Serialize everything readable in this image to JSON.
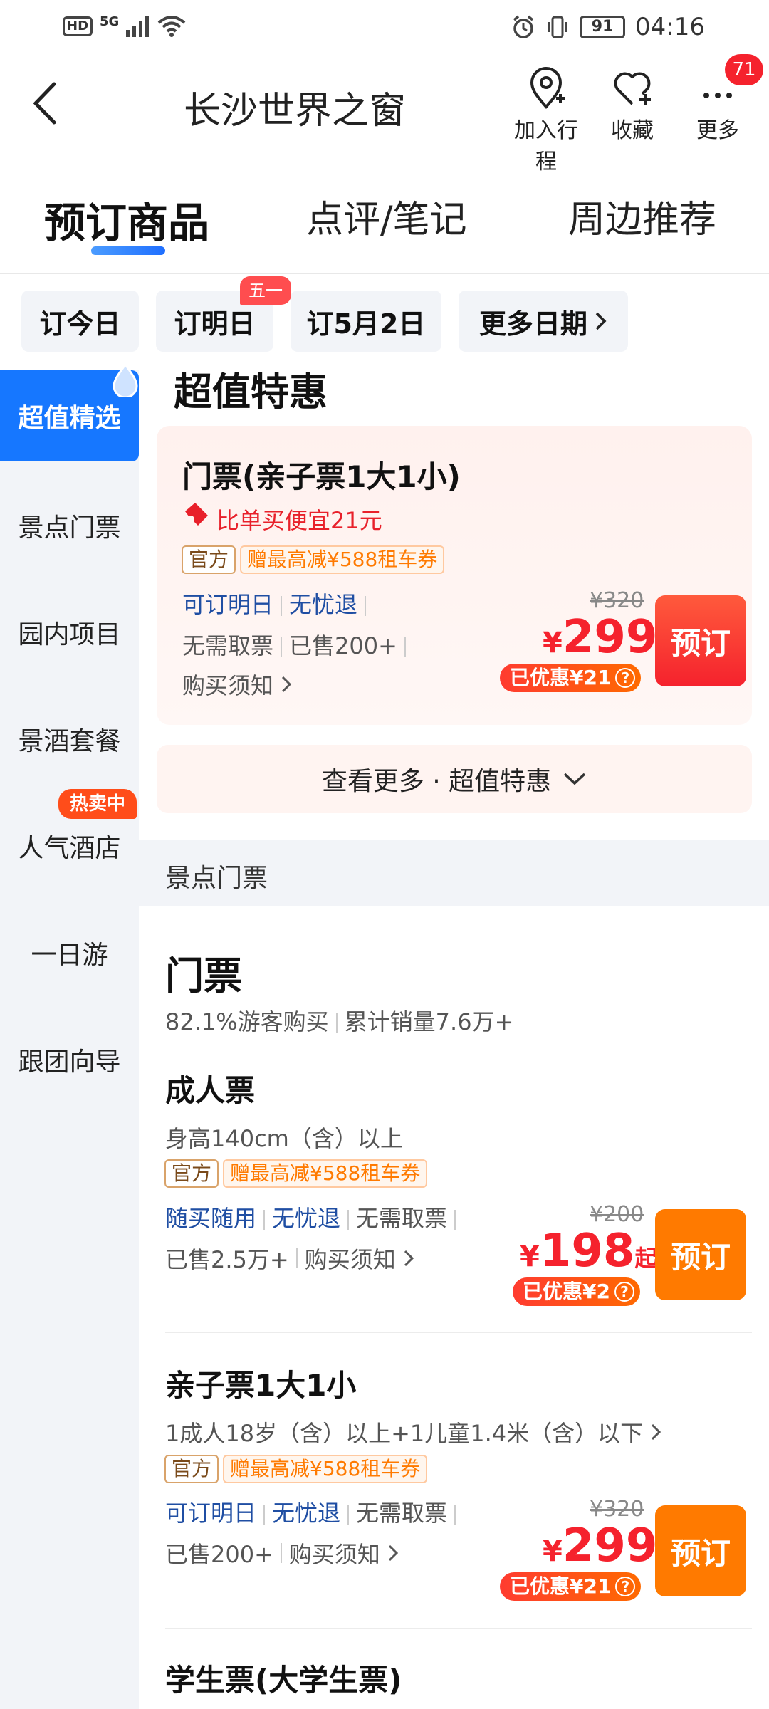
{
  "status_bar": {
    "hd": "HD",
    "network": "5G",
    "battery": "91",
    "time": "04:16"
  },
  "header": {
    "title": "长沙世界之窗",
    "actions": [
      {
        "label": "加入行程",
        "icon": "map-pin-plus-icon"
      },
      {
        "label": "收藏",
        "icon": "heart-plus-icon"
      },
      {
        "label": "更多",
        "icon": "more-dots-icon"
      }
    ],
    "notification_count": "71"
  },
  "tabs": [
    {
      "label": "预订商品",
      "active": true
    },
    {
      "label": "点评/笔记",
      "active": false
    },
    {
      "label": "周边推荐",
      "active": false
    }
  ],
  "date_chips": {
    "today": "订今日",
    "tomorrow": "订明日",
    "holiday_badge": "五一",
    "may2": "订5月2日",
    "more": "更多日期"
  },
  "sidebar": {
    "items": [
      "超值精选",
      "景点门票",
      "园内项目",
      "景酒套餐",
      "人气酒店",
      "一日游",
      "跟团向导"
    ],
    "active_index": 0,
    "hot_tag": "热卖中"
  },
  "deal_section": {
    "title": "超值特惠",
    "card": {
      "title": "门票(亲子票1大1小)",
      "savings": "比单买便宜21元",
      "tag_official": "官方",
      "tag_gift": "赠最高减¥588租车券",
      "feature1": "可订明日",
      "feature2": "无忧退",
      "feature3": "无需取票",
      "sold": "已售200+",
      "notice": "购买须知",
      "original_price": "¥320",
      "currency": "¥",
      "price": "299",
      "discount": "已优惠¥21",
      "book": "预订"
    },
    "more_label": "查看更多 · 超值特惠"
  },
  "ticket_section": {
    "band_label": "景点门票",
    "title": "门票",
    "buy_rate": "82.1%游客购买",
    "total_sales": "累计销量7.6万+",
    "products": [
      {
        "name": "成人票",
        "desc": "身高140cm（含）以上",
        "tag_official": "官方",
        "tag_gift": "赠最高减¥588租车券",
        "feature1": "随买随用",
        "feature2": "无忧退",
        "feature3": "无需取票",
        "sold": "已售2.5万+",
        "notice": "购买须知",
        "original_price": "¥200",
        "currency": "¥",
        "price": "198",
        "suffix": "起",
        "discount": "已优惠¥2",
        "book": "预订"
      },
      {
        "name": "亲子票1大1小",
        "desc": "1成人18岁（含）以上+1儿童1.4米（含）以下",
        "tag_official": "官方",
        "tag_gift": "赠最高减¥588租车券",
        "feature1": "可订明日",
        "feature2": "无忧退",
        "feature3": "无需取票",
        "sold": "已售200+",
        "notice": "购买须知",
        "original_price": "¥320",
        "currency": "¥",
        "price": "299",
        "discount": "已优惠¥21",
        "book": "预订"
      },
      {
        "name": "学生票(大学生票)"
      }
    ]
  },
  "colors": {
    "accent_blue": "#1677ff",
    "price_red": "#f5222d",
    "book_orange": "#ff7a00"
  }
}
